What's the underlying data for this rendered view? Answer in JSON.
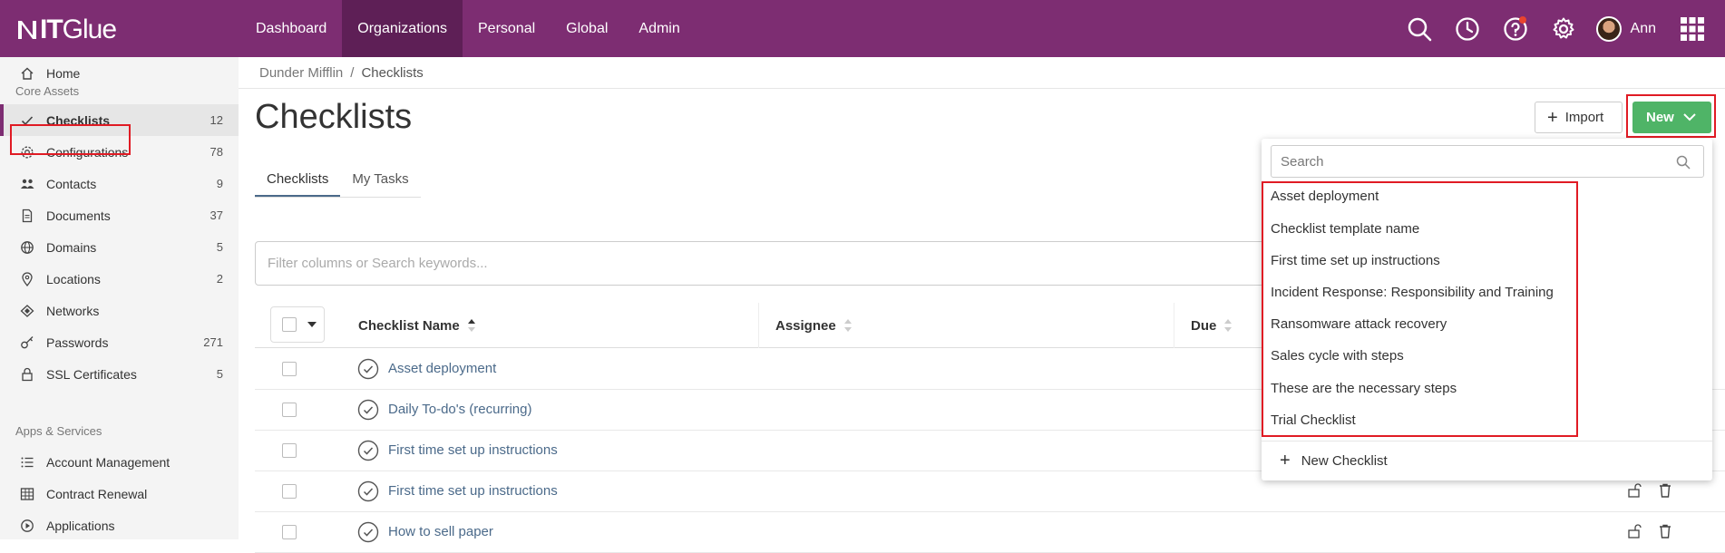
{
  "app": {
    "logo_prefix": "IT",
    "logo_suffix": "Glue",
    "user_name": "Ann"
  },
  "nav": {
    "items": [
      {
        "label": "Dashboard"
      },
      {
        "label": "Organizations"
      },
      {
        "label": "Personal"
      },
      {
        "label": "Global"
      },
      {
        "label": "Admin"
      }
    ],
    "active": "Organizations"
  },
  "sidebar": {
    "home": "Home",
    "section_core": "Core Assets",
    "section_apps": "Apps & Services",
    "items": [
      {
        "label": "Checklists",
        "count": "12",
        "icon": "check-icon"
      },
      {
        "label": "Configurations",
        "count": "78",
        "icon": "gear-icon"
      },
      {
        "label": "Contacts",
        "count": "9",
        "icon": "people-icon"
      },
      {
        "label": "Documents",
        "count": "37",
        "icon": "document-icon"
      },
      {
        "label": "Domains",
        "count": "5",
        "icon": "globe-icon"
      },
      {
        "label": "Locations",
        "count": "2",
        "icon": "location-pin-icon"
      },
      {
        "label": "Networks",
        "count": "",
        "icon": "network-icon"
      },
      {
        "label": "Passwords",
        "count": "271",
        "icon": "key-icon"
      },
      {
        "label": "SSL Certificates",
        "count": "5",
        "icon": "lock-icon"
      }
    ],
    "apps": [
      {
        "label": "Account Management",
        "icon": "list-icon"
      },
      {
        "label": "Contract Renewal",
        "icon": "grid-icon"
      },
      {
        "label": "Applications",
        "icon": "play-circle-icon"
      }
    ]
  },
  "breadcrumb": {
    "org": "Dunder Mifflin",
    "separator": "/",
    "current": "Checklists"
  },
  "page": {
    "title": "Checklists",
    "tabs": [
      "Checklists",
      "My Tasks"
    ],
    "filter_placeholder": "Filter columns or Search keywords..."
  },
  "table": {
    "columns": [
      "Checklist Name",
      "Assignee",
      "Due"
    ],
    "rows": [
      {
        "name": "Asset deployment"
      },
      {
        "name": "Daily To-do's (recurring)"
      },
      {
        "name": "First time set up instructions"
      },
      {
        "name": "First time set up instructions"
      },
      {
        "name": "How to sell paper"
      }
    ]
  },
  "actions": {
    "import_label": "Import",
    "new_label": "New"
  },
  "dropdown": {
    "search_placeholder": "Search",
    "templates": [
      "Asset deployment",
      "Checklist template name",
      "First time set up instructions",
      "Incident Response: Responsibility and Training",
      "Ransomware attack recovery",
      "Sales cycle with steps",
      "These are the necessary steps",
      "Trial Checklist"
    ],
    "new_checklist_label": "New Checklist"
  },
  "colors": {
    "brand": "#7d2d72",
    "brand_dark": "#5e1f56",
    "new_button": "#4fb467",
    "link": "#4b6a8a",
    "highlight": "#e01b24"
  }
}
